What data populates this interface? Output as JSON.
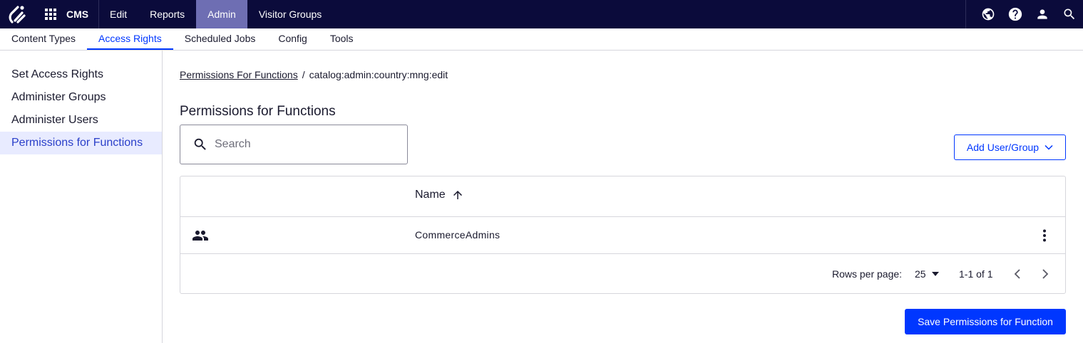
{
  "topbar": {
    "product": "CMS",
    "nav": [
      "Edit",
      "Reports",
      "Admin",
      "Visitor Groups"
    ],
    "active_nav": "Admin",
    "icons": [
      "globe-icon",
      "help-icon",
      "user-icon",
      "search-icon"
    ]
  },
  "subnav": {
    "items": [
      "Content Types",
      "Access Rights",
      "Scheduled Jobs",
      "Config",
      "Tools"
    ],
    "active": "Access Rights"
  },
  "sidebar": {
    "items": [
      "Set Access Rights",
      "Administer Groups",
      "Administer Users",
      "Permissions for Functions"
    ],
    "active": "Permissions for Functions"
  },
  "breadcrumb": {
    "link": "Permissions For Functions",
    "separator": "/",
    "current": "catalog:admin:country:mng:edit"
  },
  "page_title": "Permissions for Functions",
  "search": {
    "placeholder": "Search",
    "value": ""
  },
  "add_button": "Add User/Group",
  "table": {
    "columns": [
      "Name"
    ],
    "sort": "ascending",
    "rows": [
      {
        "type": "group",
        "name": "CommerceAdmins"
      }
    ],
    "pagination": {
      "rows_per_page_label": "Rows per page:",
      "rows_per_page": "25",
      "range": "1-1 of 1"
    }
  },
  "save_button": "Save Permissions for Function",
  "colors": {
    "topbar_bg": "#0b0b3b",
    "active_top_tab": "#6e6eb3",
    "accent": "#0037ff",
    "sidebar_active_bg": "#e8ebff"
  }
}
